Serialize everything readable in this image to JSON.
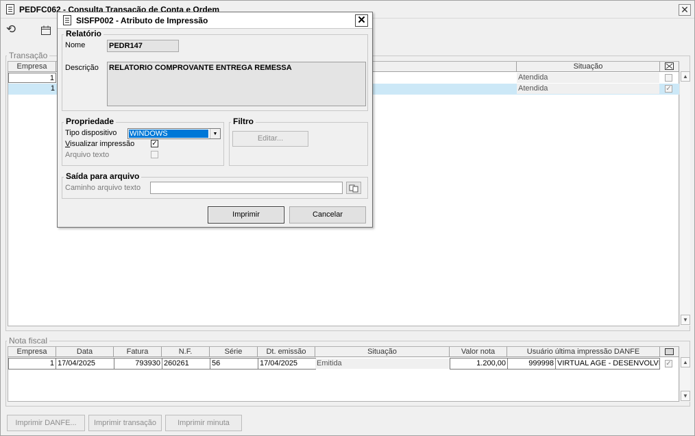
{
  "main": {
    "title": "PEDFC062 - Consulta Transação de Conta e Ordem",
    "close_glyph": "✕",
    "toolbar": {
      "refresh_icon": "refresh-icon",
      "calendar_icon": "calendar-icon"
    },
    "transacao": {
      "group_label": "Transação",
      "columns": [
        "Empresa",
        "Situação"
      ],
      "rows": [
        {
          "empresa": "1",
          "situacao": "Atendida",
          "checked": false
        },
        {
          "empresa": "1",
          "situacao": "Atendida",
          "checked": true
        }
      ]
    },
    "nota_fiscal": {
      "group_label": "Nota fiscal",
      "columns": [
        "Empresa",
        "Data",
        "Fatura",
        "N.F.",
        "Série",
        "Dt. emissão",
        "Situação",
        "Valor nota",
        "Usuário última impressão DANFE"
      ],
      "rows": [
        {
          "empresa": "1",
          "data": "17/04/2025",
          "fatura": "793930",
          "nf": "260261",
          "serie": "56",
          "dt_emissao": "17/04/2025",
          "situacao": "Emitida",
          "valor_nota": "1.200,00",
          "usuario_cod": "999998",
          "usuario_nome": "VIRTUAL AGE - DESENVOLVIM",
          "checked": true
        }
      ]
    },
    "buttons": {
      "imprimir_danfe": "Imprimir DANFE...",
      "imprimir_transacao": "Imprimir transação",
      "imprimir_minuta": "Imprimir minuta"
    }
  },
  "dialog": {
    "title": "SISFP002 - Atributo de Impressão",
    "close_glyph": "✕",
    "relatorio": {
      "group_label": "Relatório",
      "nome_label": "Nome",
      "nome_value": "PEDR147",
      "descricao_label": "Descrição",
      "descricao_value": "RELATORIO COMPROVANTE ENTREGA REMESSA"
    },
    "propriedade": {
      "group_label": "Propriedade",
      "tipo_dispositivo_label": "Tipo dispositivo",
      "tipo_dispositivo_value": "WINDOWS",
      "visualizar_label": "Visualizar impressão",
      "visualizar_checked": true,
      "arquivo_texto_label": "Arquivo texto",
      "arquivo_texto_checked": false
    },
    "filtro": {
      "group_label": "Filtro",
      "editar_label": "Editar..."
    },
    "saida": {
      "group_label": "Saída para arquivo",
      "caminho_label": "Caminho arquivo texto",
      "caminho_value": ""
    },
    "imprimir_label": "Imprimir",
    "cancelar_label": "Cancelar"
  }
}
